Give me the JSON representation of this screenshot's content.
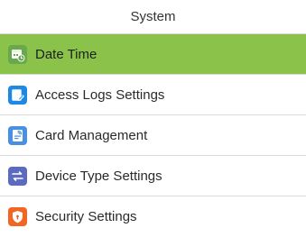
{
  "header": {
    "title": "System"
  },
  "menu": {
    "items": [
      {
        "label": "Date Time",
        "icon": "calendar-clock-icon",
        "selected": true
      },
      {
        "label": "Access Logs Settings",
        "icon": "log-edit-icon",
        "selected": false
      },
      {
        "label": "Card Management",
        "icon": "card-icon",
        "selected": false
      },
      {
        "label": "Device Type Settings",
        "icon": "device-type-icon",
        "selected": false
      },
      {
        "label": "Security Settings",
        "icon": "shield-icon",
        "selected": false
      }
    ]
  },
  "colors": {
    "selected_background": "#8bc34a",
    "date_time_icon": "#6aa84f",
    "access_logs_icon": "#1e88e5",
    "card_icon": "#4a90e2",
    "device_type_icon": "#5c6bc0",
    "security_icon": "#f26522"
  }
}
